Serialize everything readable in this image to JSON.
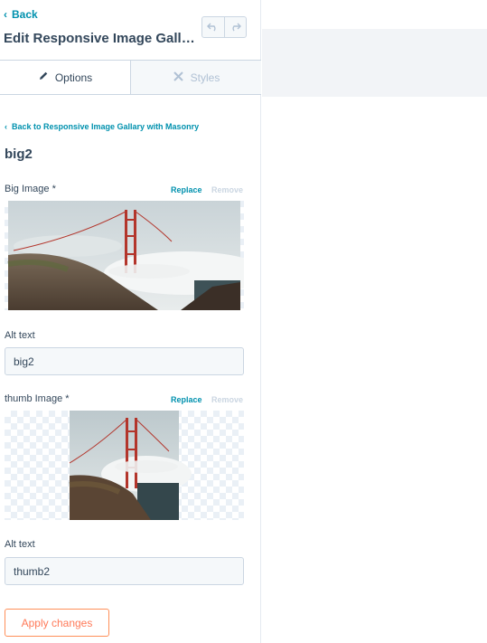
{
  "header": {
    "back_label": "Back",
    "title": "Edit Responsive Image Gallary with Masonry",
    "undo_icon": "undo-icon",
    "redo_icon": "redo-icon"
  },
  "tabs": [
    {
      "label": "Options",
      "icon": "pencil-icon",
      "active": true
    },
    {
      "label": "Styles",
      "icon": "styles-icon",
      "active": false
    }
  ],
  "breadcrumb": "Back to Responsive Image Gallary with Masonry",
  "section_title": "big2",
  "big_image": {
    "label": "Big Image *",
    "replace_label": "Replace",
    "remove_label": "Remove",
    "alt_label": "Alt text",
    "alt_value": "big2"
  },
  "thumb_image": {
    "label": "thumb Image *",
    "replace_label": "Replace",
    "remove_label": "Remove",
    "alt_label": "Alt text",
    "alt_value": "thumb2"
  },
  "apply_label": "Apply changes",
  "colors": {
    "link": "#0091ae",
    "accent": "#ff7a59",
    "text": "#33475b"
  }
}
